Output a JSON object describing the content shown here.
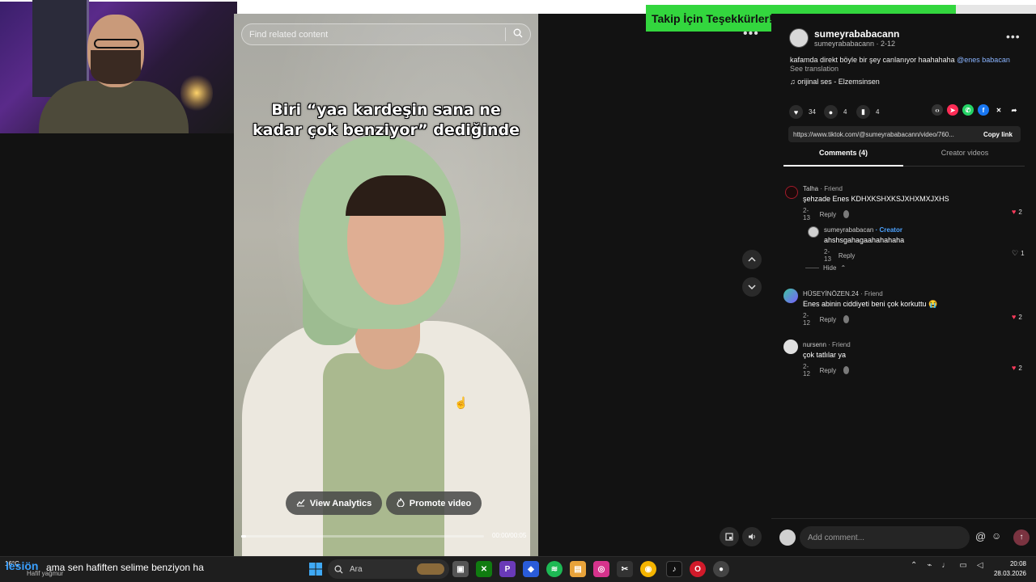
{
  "stream_bar": {
    "label": "Takip İçin Teşekkürler!!!",
    "count": "159",
    "goal": "200"
  },
  "video": {
    "search_placeholder": "Find related content",
    "caption_line1": "Biri “yaa kardeşin sana ne",
    "caption_line2": "kadar çok benziyor” dediğinde",
    "analytics_label": "View Analytics",
    "promote_label": "Promote video",
    "time": "00:00/00:05",
    "progress": 0.02
  },
  "post": {
    "author_name": "sumeyrababacann",
    "author_sub": "sumeyrababacann · 2-12",
    "description": "kafamda direkt böyle bir şey canlanıyor haahahaha ",
    "mention": "@enes babacan",
    "see_translation": "See translation",
    "music": "orijinal ses - Elzemsinsen",
    "likes": "34",
    "comments": "4",
    "saves": "4",
    "link": "https://www.tiktok.com/@sumeyrababacann/video/760...",
    "copy_link": "Copy link"
  },
  "tabs": {
    "comments": "Comments (4)",
    "creator": "Creator videos"
  },
  "comments": [
    {
      "name": "Talha",
      "tag": " · Friend",
      "text": "şehzade Enes KDHXKSHXKSJXHXMXJXHS",
      "date": "2-13",
      "reply": "Reply",
      "likes": "2"
    },
    {
      "name": "sumeyrababacan",
      "tag": " · Creator",
      "text": "ahshsgahagaahahahaha",
      "date": "2-13",
      "reply": "Reply",
      "likes": "1"
    },
    {
      "name": "HÜSEYİNÖZEN.24",
      "tag": " · Friend",
      "text": "Enes abinin ciddiyeti beni çok korkuttu 😭",
      "date": "2-12",
      "reply": "Reply",
      "likes": "2"
    },
    {
      "name": "nursenn",
      "tag": " · Friend",
      "text": "çok tatlılar ya",
      "date": "2-12",
      "reply": "Reply",
      "likes": "2"
    }
  ],
  "hide_label": "Hide",
  "comment_input": {
    "placeholder": "Add comment..."
  },
  "taskbar": {
    "weather_temp": "16°C",
    "weather_cond": "Hafif yağmur",
    "chat_user": "lesiön",
    "chat_message": "ama sen hafiften selime benziyon ha",
    "search_label": "Ara",
    "time": "20:08",
    "date": "28.03.2026"
  }
}
